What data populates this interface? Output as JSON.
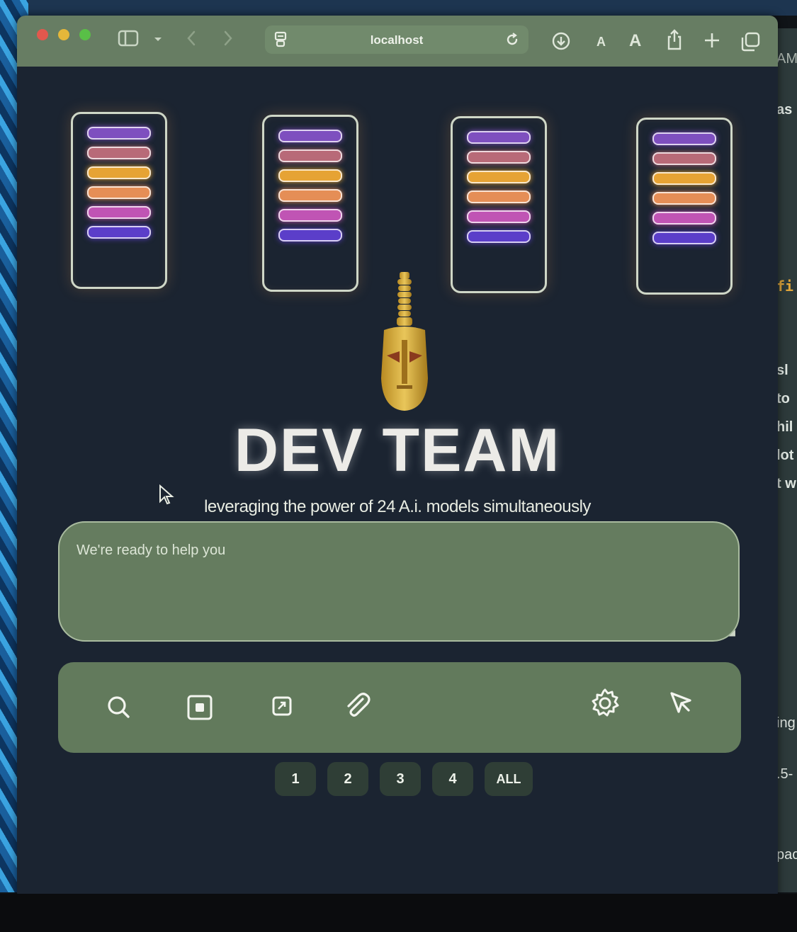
{
  "browser": {
    "address": "localhost"
  },
  "racks": {
    "bar_colors": [
      "#7e4fbf",
      "#b86a78",
      "#e6a334",
      "#e58e56",
      "#c054b4",
      "#5b3ec9"
    ]
  },
  "hero": {
    "title": "DEV TEAM",
    "subtitle": "leveraging the power of 24 A.i. models simultaneously"
  },
  "prompt": {
    "placeholder": "We're ready to help you"
  },
  "actions": {
    "icons": [
      "search-icon",
      "screenshot-icon",
      "open-file-icon",
      "paperclip-icon",
      "gear-icon",
      "cursor-select-icon"
    ]
  },
  "pages": {
    "items": [
      "1",
      "2",
      "3",
      "4",
      "ALL"
    ]
  },
  "side_window": {
    "snippets": [
      "AM",
      "as",
      "fi",
      "sl",
      "to",
      "hil",
      "lot",
      "t w",
      "ing",
      ".5-",
      "pac"
    ]
  },
  "colors": {
    "toolbar": "#677d63",
    "page_bg": "#1b2431",
    "panel": "#657c5f"
  }
}
